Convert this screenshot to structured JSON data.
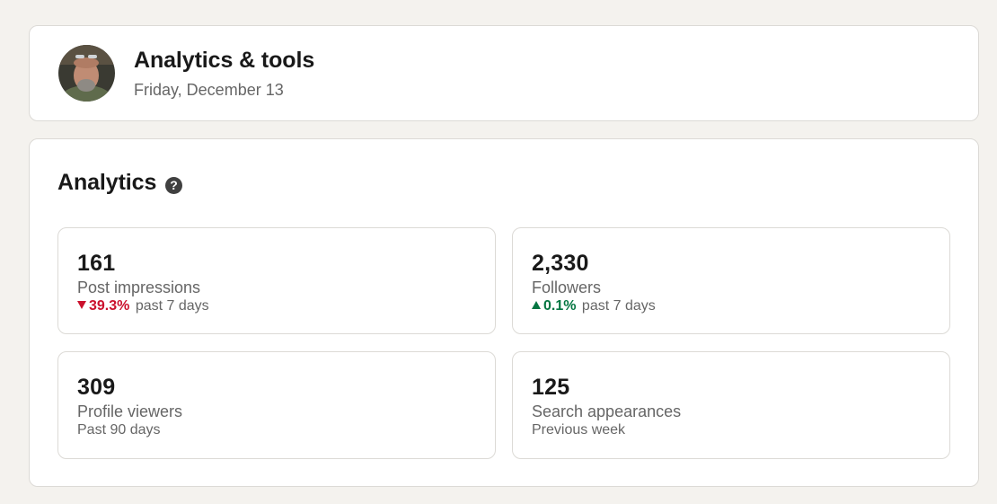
{
  "header": {
    "title": "Analytics & tools",
    "date": "Friday, December 13"
  },
  "analytics": {
    "title": "Analytics",
    "help_icon": "question-circle-icon",
    "metrics": [
      {
        "value": "161",
        "label": "Post impressions",
        "trend": {
          "direction": "down",
          "percent": "39.3%",
          "period": "past 7 days",
          "color": "#cb112d"
        }
      },
      {
        "value": "2,330",
        "label": "Followers",
        "trend": {
          "direction": "up",
          "percent": "0.1%",
          "period": "past 7 days",
          "color": "#057642"
        }
      },
      {
        "value": "309",
        "label": "Profile viewers",
        "sub": "Past 90 days"
      },
      {
        "value": "125",
        "label": "Search appearances",
        "sub": "Previous week"
      }
    ]
  },
  "colors": {
    "page_background": "#f4f2ee",
    "card_background": "#ffffff",
    "border": "#dcdad6",
    "text_primary": "#191919",
    "text_secondary": "#666666"
  }
}
